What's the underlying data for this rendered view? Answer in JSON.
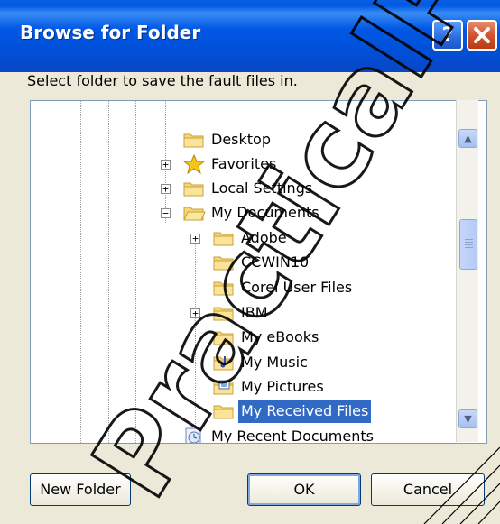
{
  "window": {
    "title": "Browse for Folder"
  },
  "title_buttons": {
    "help": "?",
    "close": "X"
  },
  "prompt": "Select folder to save the fault files in.",
  "tree": {
    "items": [
      {
        "label": "Desktop",
        "expander": "",
        "icon": "folder-icon"
      },
      {
        "label": "Favorites",
        "expander": "+",
        "icon": "favorites-star-icon"
      },
      {
        "label": "Local Settings",
        "expander": "+",
        "icon": "folder-icon"
      },
      {
        "label": "My Documents",
        "expander": "−",
        "icon": "open-folder-icon"
      },
      {
        "label": "Adobe",
        "expander": "+",
        "icon": "folder-icon"
      },
      {
        "label": "CCWIN10",
        "expander": "",
        "icon": "folder-icon"
      },
      {
        "label": "Corel User Files",
        "expander": "",
        "icon": "folder-icon"
      },
      {
        "label": "IBM",
        "expander": "+",
        "icon": "folder-icon"
      },
      {
        "label": "My eBooks",
        "expander": "",
        "icon": "folder-icon"
      },
      {
        "label": "My Music",
        "expander": "",
        "icon": "music-folder-icon"
      },
      {
        "label": "My Pictures",
        "expander": "",
        "icon": "pictures-folder-icon"
      },
      {
        "label": "My Received Files",
        "expander": "",
        "icon": "folder-icon",
        "selected": true
      },
      {
        "label": "My Recent Documents",
        "expander": "",
        "icon": "recent-documents-icon"
      }
    ]
  },
  "scrollbar": {
    "up": "▲",
    "down": "▼"
  },
  "buttons": {
    "new_folder": "New Folder",
    "ok": "OK",
    "cancel": "Cancel"
  },
  "watermark": {
    "text": "PracticalPC"
  },
  "colors": {
    "titlebar": "#0058e6",
    "selection": "#316ac5",
    "dialog_bg": "#ece9d8"
  }
}
